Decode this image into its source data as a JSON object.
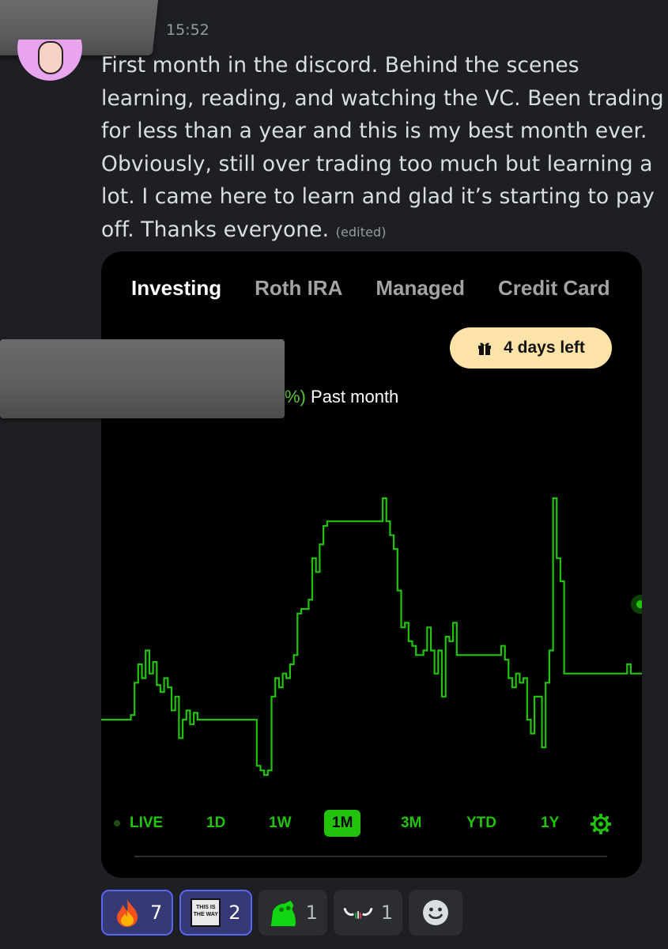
{
  "message": {
    "timestamp": "15:52",
    "text": "First month in the discord. Behind the scenes learning, reading, and watching the VC. Been trading for less than a year and this is my best month ever. Obviously, still over trading too much but learning a lot. I came here to learn and glad it’s starting to pay off. Thanks everyone.",
    "edited_label": "(edited)"
  },
  "embed": {
    "tabs": [
      "Investing",
      "Roth IRA",
      "Managed",
      "Credit Card"
    ],
    "active_tab": "Investing",
    "promo": {
      "label": "4 days left",
      "icon": "gift-icon"
    },
    "gain": {
      "suffix_accent": "%)",
      "period": "Past month"
    },
    "ranges": [
      "LIVE",
      "1D",
      "1W",
      "1M",
      "3M",
      "YTD",
      "1Y"
    ],
    "active_range": "1M",
    "colors": {
      "line": "#21c40a",
      "promo_bg": "#fde3a7",
      "background": "#000000"
    }
  },
  "chart_data": {
    "type": "line",
    "title": "",
    "xlabel": "",
    "ylabel": "",
    "series": [
      {
        "values": [
          10,
          10,
          10,
          10,
          10,
          10,
          10,
          10,
          12,
          26,
          34,
          28,
          40,
          30,
          35,
          25,
          22,
          28,
          24,
          14,
          20,
          2,
          10,
          14,
          8,
          13,
          10,
          10,
          10,
          10,
          10,
          10,
          10,
          10,
          10,
          10,
          10,
          10,
          10,
          10,
          10,
          10,
          -10,
          -12,
          -14,
          -12,
          20,
          28,
          24,
          30,
          28,
          34,
          38,
          56,
          58,
          58,
          62,
          80,
          74,
          86,
          94,
          96,
          96,
          96,
          96,
          96,
          96,
          96,
          96,
          96,
          96,
          96,
          96,
          96,
          96,
          96,
          106,
          96,
          90,
          84,
          66,
          50,
          52,
          44,
          42,
          38,
          38,
          40,
          50,
          40,
          30,
          40,
          20,
          46,
          44,
          52,
          38,
          38,
          38,
          38,
          38,
          38,
          38,
          38,
          38,
          38,
          38,
          38,
          42,
          36,
          28,
          24,
          30,
          26,
          28,
          10,
          4,
          20,
          20,
          -2,
          26,
          40,
          106,
          80,
          70,
          30,
          30,
          30,
          30,
          30,
          30,
          30,
          30,
          30,
          30,
          30,
          30,
          30,
          30,
          30,
          30,
          30,
          34,
          30,
          30,
          30,
          30
        ]
      }
    ],
    "line_color": "#21c40a",
    "grid": false,
    "legend": "none"
  },
  "reactions": [
    {
      "emoji": "fire-emoji",
      "count": "7",
      "me": true
    },
    {
      "emoji": "this-is-the-way-emoji",
      "label": "THIS IS THE WAY",
      "count": "2",
      "me": true
    },
    {
      "emoji": "green-frog-emoji",
      "count": "1",
      "me": false
    },
    {
      "emoji": "bull-emoji",
      "count": "1",
      "me": false
    }
  ]
}
